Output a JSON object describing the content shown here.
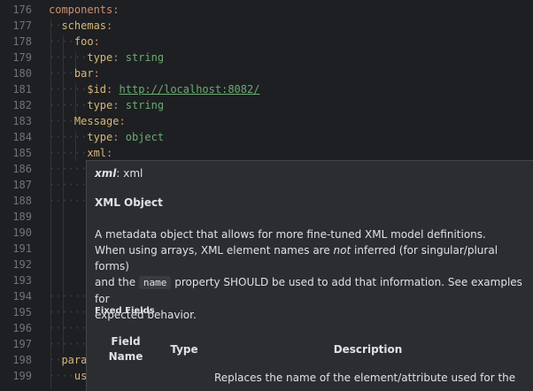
{
  "line_numbers": [
    "176",
    "177",
    "178",
    "179",
    "180",
    "181",
    "182",
    "183",
    "184",
    "185",
    "186",
    "187",
    "188",
    "189",
    "190",
    "191",
    "192",
    "193",
    "194",
    "195",
    "196",
    "197",
    "198",
    "199"
  ],
  "code": {
    "l176_key": "components",
    "l177_key": "schemas",
    "l178_key": "foo",
    "l179_key": "type",
    "l179_val": "string",
    "l180_key": "bar",
    "l181_key": "$id",
    "l181_val": "http://localhost:8082/",
    "l182_key": "type",
    "l182_val": "string",
    "l183_key": "Message",
    "l184_key": "type",
    "l184_val": "object",
    "l185_key": "xml",
    "l198_key": "para",
    "l199_key": "us"
  },
  "colon": ":",
  "popup": {
    "head_italic": "xml",
    "head_rest": ": xml",
    "title": "XML Object",
    "desc_line1": "A metadata object that allows for more fine-tuned XML model definitions.",
    "desc_line2_a": "When using arrays, XML element names are ",
    "desc_line2_em": "not",
    "desc_line2_b": " inferred (for singular/plural forms)",
    "desc_line3_a": "and the ",
    "desc_line3_code": "name",
    "desc_line3_b": " property SHOULD be used to add that information. See examples for",
    "desc_line4": "expected behavior.",
    "fixed_fields": "Fixed Fields",
    "col_field_1": "Field",
    "col_field_2": "Name",
    "col_type": "Type",
    "col_desc": "Description",
    "row1_desc": "Replaces the name of the element/attribute used for the"
  },
  "colors": {
    "background": "#1e1f22",
    "popup_bg": "#2b2d30",
    "key": "#d5b778",
    "string": "#6aab73"
  }
}
